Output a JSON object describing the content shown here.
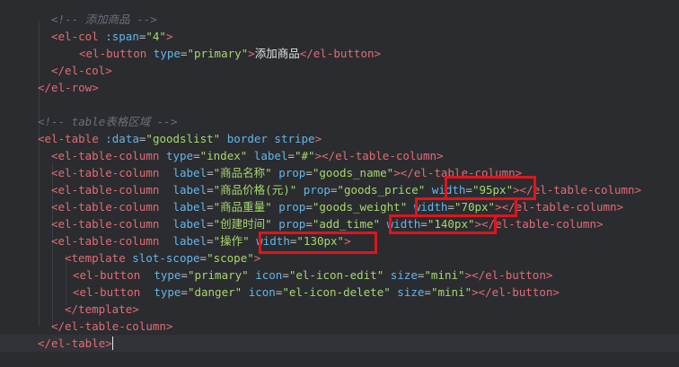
{
  "editor": {
    "lines": [
      [
        {
          "t": "<!-- 添加商品 -->",
          "c": "c-comment"
        }
      ],
      [
        {
          "t": "<el-col",
          "c": "c-tag"
        },
        {
          "t": " :span",
          "c": "c-attr"
        },
        {
          "t": "=",
          "c": "c-punct"
        },
        {
          "t": "\"4\"",
          "c": "c-str"
        },
        {
          "t": ">",
          "c": "c-tag"
        }
      ],
      [
        {
          "t": "<el-button",
          "c": "c-tag"
        },
        {
          "t": " type",
          "c": "c-attr"
        },
        {
          "t": "=",
          "c": "c-punct"
        },
        {
          "t": "\"primary\"",
          "c": "c-str"
        },
        {
          "t": ">",
          "c": "c-tag"
        },
        {
          "t": "添加商品",
          "c": "c-text"
        },
        {
          "t": "</el-button>",
          "c": "c-tag"
        }
      ],
      [
        {
          "t": "</el-col>",
          "c": "c-tag"
        }
      ],
      [
        {
          "t": "</el-row>",
          "c": "c-tag"
        }
      ],
      [],
      [
        {
          "t": "<!-- table表格区域 -->",
          "c": "c-comment"
        }
      ],
      [
        {
          "t": "<el-table",
          "c": "c-tag"
        },
        {
          "t": " :data",
          "c": "c-attr"
        },
        {
          "t": "=",
          "c": "c-punct"
        },
        {
          "t": "\"goodslist\"",
          "c": "c-str"
        },
        {
          "t": " border stripe",
          "c": "c-attr"
        },
        {
          "t": ">",
          "c": "c-tag"
        }
      ],
      [
        {
          "t": "<el-table-column",
          "c": "c-tag"
        },
        {
          "t": " type",
          "c": "c-attr"
        },
        {
          "t": "=",
          "c": "c-punct"
        },
        {
          "t": "\"index\"",
          "c": "c-str"
        },
        {
          "t": " label",
          "c": "c-attr"
        },
        {
          "t": "=",
          "c": "c-punct"
        },
        {
          "t": "\"#\"",
          "c": "c-str"
        },
        {
          "t": "></el-table-column>",
          "c": "c-tag"
        }
      ],
      [
        {
          "t": "<el-table-column",
          "c": "c-tag"
        },
        {
          "t": "  label",
          "c": "c-attr"
        },
        {
          "t": "=",
          "c": "c-punct"
        },
        {
          "t": "\"商品名称\"",
          "c": "c-str"
        },
        {
          "t": " prop",
          "c": "c-attr"
        },
        {
          "t": "=",
          "c": "c-punct"
        },
        {
          "t": "\"goods_name\"",
          "c": "c-str"
        },
        {
          "t": "></el-table-column>",
          "c": "c-tag"
        }
      ],
      [
        {
          "t": "<el-table-column",
          "c": "c-tag"
        },
        {
          "t": "  label",
          "c": "c-attr"
        },
        {
          "t": "=",
          "c": "c-punct"
        },
        {
          "t": "\"商品价格(元)\"",
          "c": "c-str"
        },
        {
          "t": " prop",
          "c": "c-attr"
        },
        {
          "t": "=",
          "c": "c-punct"
        },
        {
          "t": "\"goods_price\"",
          "c": "c-str"
        },
        {
          "t": " width",
          "c": "c-attr"
        },
        {
          "t": "=",
          "c": "c-punct"
        },
        {
          "t": "\"95px\"",
          "c": "c-str"
        },
        {
          "t": "></el-table-column>",
          "c": "c-tag"
        }
      ],
      [
        {
          "t": "<el-table-column",
          "c": "c-tag"
        },
        {
          "t": "  label",
          "c": "c-attr"
        },
        {
          "t": "=",
          "c": "c-punct"
        },
        {
          "t": "\"商品重量\"",
          "c": "c-str"
        },
        {
          "t": " prop",
          "c": "c-attr"
        },
        {
          "t": "=",
          "c": "c-punct"
        },
        {
          "t": "\"goods_weight\"",
          "c": "c-str"
        },
        {
          "t": " width",
          "c": "c-attr"
        },
        {
          "t": "=",
          "c": "c-punct"
        },
        {
          "t": "\"70px\"",
          "c": "c-str"
        },
        {
          "t": "></el-table-column>",
          "c": "c-tag"
        }
      ],
      [
        {
          "t": "<el-table-column",
          "c": "c-tag"
        },
        {
          "t": "  label",
          "c": "c-attr"
        },
        {
          "t": "=",
          "c": "c-punct"
        },
        {
          "t": "\"创建时间\"",
          "c": "c-str"
        },
        {
          "t": " prop",
          "c": "c-attr"
        },
        {
          "t": "=",
          "c": "c-punct"
        },
        {
          "t": "\"add_time\"",
          "c": "c-str"
        },
        {
          "t": " width",
          "c": "c-attr"
        },
        {
          "t": "=",
          "c": "c-punct"
        },
        {
          "t": "\"140px\"",
          "c": "c-str"
        },
        {
          "t": "></el-table-column>",
          "c": "c-tag"
        }
      ],
      [
        {
          "t": "<el-table-column",
          "c": "c-tag"
        },
        {
          "t": "  label",
          "c": "c-attr"
        },
        {
          "t": "=",
          "c": "c-punct"
        },
        {
          "t": "\"操作\"",
          "c": "c-str"
        },
        {
          "t": " width",
          "c": "c-attr"
        },
        {
          "t": "=",
          "c": "c-punct"
        },
        {
          "t": "\"130px\"",
          "c": "c-str"
        },
        {
          "t": ">",
          "c": "c-tag"
        }
      ],
      [
        {
          "t": "<template",
          "c": "c-tag"
        },
        {
          "t": " slot-scope",
          "c": "c-attr"
        },
        {
          "t": "=",
          "c": "c-punct"
        },
        {
          "t": "\"scope\"",
          "c": "c-str"
        },
        {
          "t": ">",
          "c": "c-tag"
        }
      ],
      [
        {
          "t": "<el-button",
          "c": "c-tag"
        },
        {
          "t": "  type",
          "c": "c-attr"
        },
        {
          "t": "=",
          "c": "c-punct"
        },
        {
          "t": "\"primary\"",
          "c": "c-str"
        },
        {
          "t": " icon",
          "c": "c-attr"
        },
        {
          "t": "=",
          "c": "c-punct"
        },
        {
          "t": "\"el-icon-edit\"",
          "c": "c-str"
        },
        {
          "t": " size",
          "c": "c-attr"
        },
        {
          "t": "=",
          "c": "c-punct"
        },
        {
          "t": "\"mini\"",
          "c": "c-str"
        },
        {
          "t": "></el-button>",
          "c": "c-tag"
        }
      ],
      [
        {
          "t": "<el-button",
          "c": "c-tag"
        },
        {
          "t": "  type",
          "c": "c-attr"
        },
        {
          "t": "=",
          "c": "c-punct"
        },
        {
          "t": "\"danger\"",
          "c": "c-str"
        },
        {
          "t": " icon",
          "c": "c-attr"
        },
        {
          "t": "=",
          "c": "c-punct"
        },
        {
          "t": "\"el-icon-delete\"",
          "c": "c-str"
        },
        {
          "t": " size",
          "c": "c-attr"
        },
        {
          "t": "=",
          "c": "c-punct"
        },
        {
          "t": "\"mini\"",
          "c": "c-str"
        },
        {
          "t": "></el-button>",
          "c": "c-tag"
        }
      ],
      [
        {
          "t": "</template>",
          "c": "c-tag"
        }
      ],
      [
        {
          "t": "</el-table-column>",
          "c": "c-tag"
        }
      ],
      [
        {
          "t": "</el-table",
          "c": "c-tag"
        },
        {
          "t": ">",
          "c": "c-tag"
        }
      ]
    ],
    "highlight_color": "#e0141c",
    "colors": {
      "background": "#2b2c30",
      "tag": "#e06c75",
      "attribute": "#63b6ea",
      "string": "#a6d76e",
      "comment": "#6b6f7a",
      "text": "#e2e2e2"
    }
  }
}
